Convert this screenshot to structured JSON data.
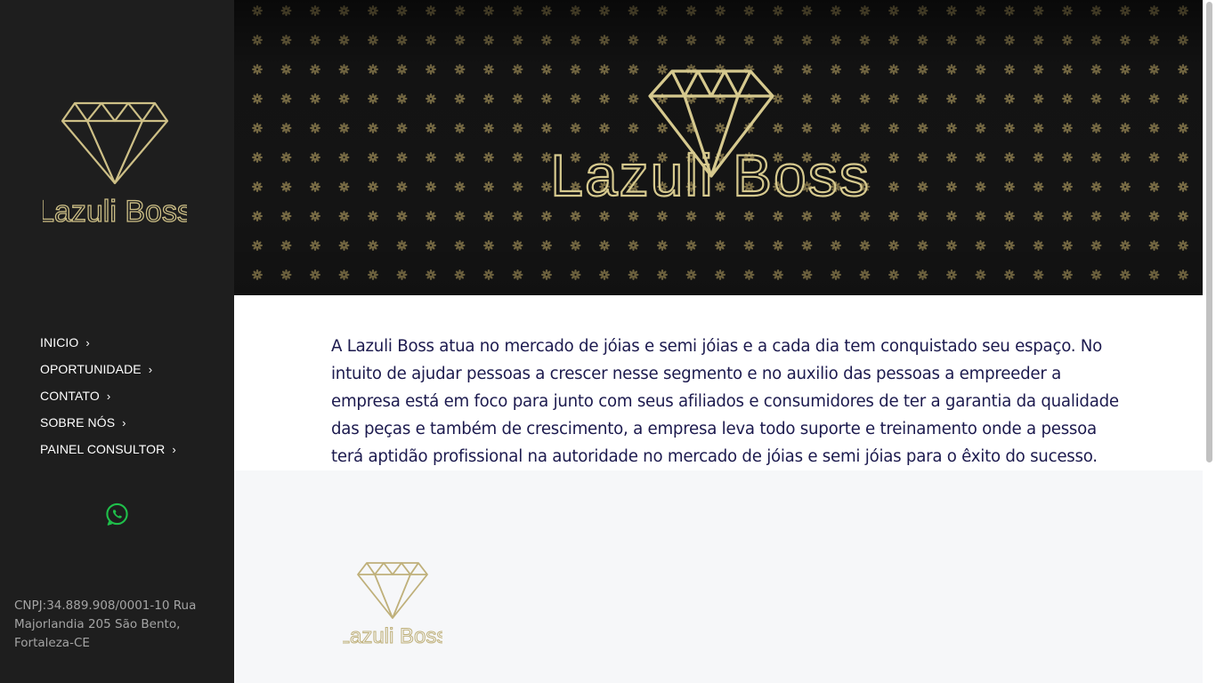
{
  "brand": {
    "logo_text": "Lazuli Boss"
  },
  "sidebar": {
    "nav": [
      {
        "label": "INICIO"
      },
      {
        "label": "OPORTUNIDADE"
      },
      {
        "label": "CONTATO"
      },
      {
        "label": "SOBRE NÓS"
      },
      {
        "label": "PAINEL CONSULTOR"
      }
    ],
    "whatsapp_icon": "whatsapp-icon",
    "footer_text": "CNPJ:34.889.908/0001-10 Rua Majorlandia 205 São Bento, Fortaleza-CE"
  },
  "main": {
    "intro": "A Lazuli Boss atua no mercado de jóias e semi jóias e a cada dia tem conquistado seu espaço. No intuito de ajudar pessoas a crescer nesse segmento e no auxilio das pessoas a empreeder a empresa está em foco para junto com seus afiliados e consumidores de ter a garantia da qualidade das peças e também de crescimento, a empresa leva todo suporte e treinamento onde a pessoa terá aptidão profissional na autoridade no mercado de jóias e semi jóias para o êxito do sucesso."
  },
  "colors": {
    "sidebar_bg": "#1e1e1e",
    "gold": "#cdbf86",
    "whatsapp": "#1fbf4a",
    "text_dark_blue": "#1c1a4e"
  }
}
